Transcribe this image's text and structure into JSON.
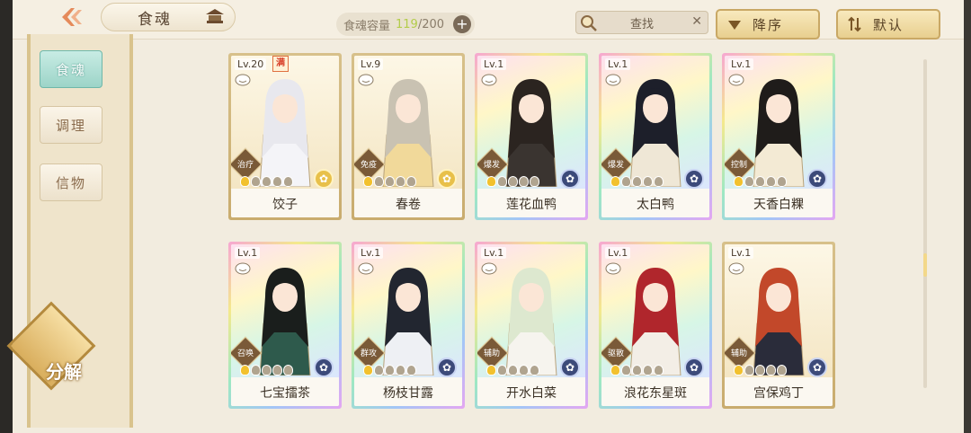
{
  "header": {
    "title": "食魂",
    "capacity_label": "食魂容量",
    "capacity_count": "119",
    "capacity_total": "/200",
    "capacity_plus": "+",
    "search_label": "查找",
    "search_clear": "✕",
    "sort_desc_label": "降序",
    "sort_default_label": "默认"
  },
  "sidebar": {
    "tabs": [
      {
        "label": "食魂",
        "active": true
      },
      {
        "label": "调理",
        "active": false
      },
      {
        "label": "信物",
        "active": false
      }
    ],
    "decompose_label": "分解"
  },
  "cards": [
    {
      "level": "Lv.20",
      "max_badge": "满",
      "role": "治疗",
      "name": "饺子",
      "frame": "gold",
      "element": "gold",
      "stars_lit": 1,
      "hair": "#e8e8ee",
      "robe": "#f4f4f8"
    },
    {
      "level": "Lv.9",
      "max_badge": "",
      "role": "免疫",
      "name": "春卷",
      "frame": "gold",
      "element": "gold",
      "stars_lit": 1,
      "hair": "#c9c2b2",
      "robe": "#f1d99a"
    },
    {
      "level": "Lv.1",
      "max_badge": "",
      "role": "爆发",
      "name": "莲花血鸭",
      "frame": "rainbow",
      "element": "dark",
      "stars_lit": 1,
      "hair": "#2b2420",
      "robe": "#3a3430"
    },
    {
      "level": "Lv.1",
      "max_badge": "",
      "role": "爆发",
      "name": "太白鸭",
      "frame": "rainbow",
      "element": "dark",
      "stars_lit": 1,
      "hair": "#1d1f2a",
      "robe": "#efe7d6"
    },
    {
      "level": "Lv.1",
      "max_badge": "",
      "role": "控制",
      "name": "天香白粿",
      "frame": "rainbow",
      "element": "dark",
      "stars_lit": 1,
      "hair": "#1f1c1a",
      "robe": "#f3ead4"
    },
    {
      "level": "Lv.1",
      "max_badge": "",
      "role": "召唤",
      "name": "七宝擂茶",
      "frame": "rainbow",
      "element": "dark",
      "stars_lit": 1,
      "hair": "#1a1e1c",
      "robe": "#2e5a4c"
    },
    {
      "level": "Lv.1",
      "max_badge": "",
      "role": "群攻",
      "name": "杨枝甘露",
      "frame": "rainbow",
      "element": "dark",
      "stars_lit": 1,
      "hair": "#222630",
      "robe": "#eef0f4"
    },
    {
      "level": "Lv.1",
      "max_badge": "",
      "role": "辅助",
      "name": "开水白菜",
      "frame": "rainbow",
      "element": "dark",
      "stars_lit": 1,
      "hair": "#dde8cf",
      "robe": "#f6f4ee"
    },
    {
      "level": "Lv.1",
      "max_badge": "",
      "role": "驱散",
      "name": "浪花东星斑",
      "frame": "rainbow",
      "element": "dark",
      "stars_lit": 1,
      "hair": "#b0262c",
      "robe": "#f3eee6"
    },
    {
      "level": "Lv.1",
      "max_badge": "",
      "role": "辅助",
      "name": "宫保鸡丁",
      "frame": "gold",
      "element": "dark",
      "stars_lit": 1,
      "hair": "#c2482a",
      "robe": "#2a2c3a"
    }
  ],
  "colors": {
    "accent_gold": "#e8cf8f",
    "active_tab": "#9cd4c8",
    "capacity_count": "#b3cc4a"
  }
}
